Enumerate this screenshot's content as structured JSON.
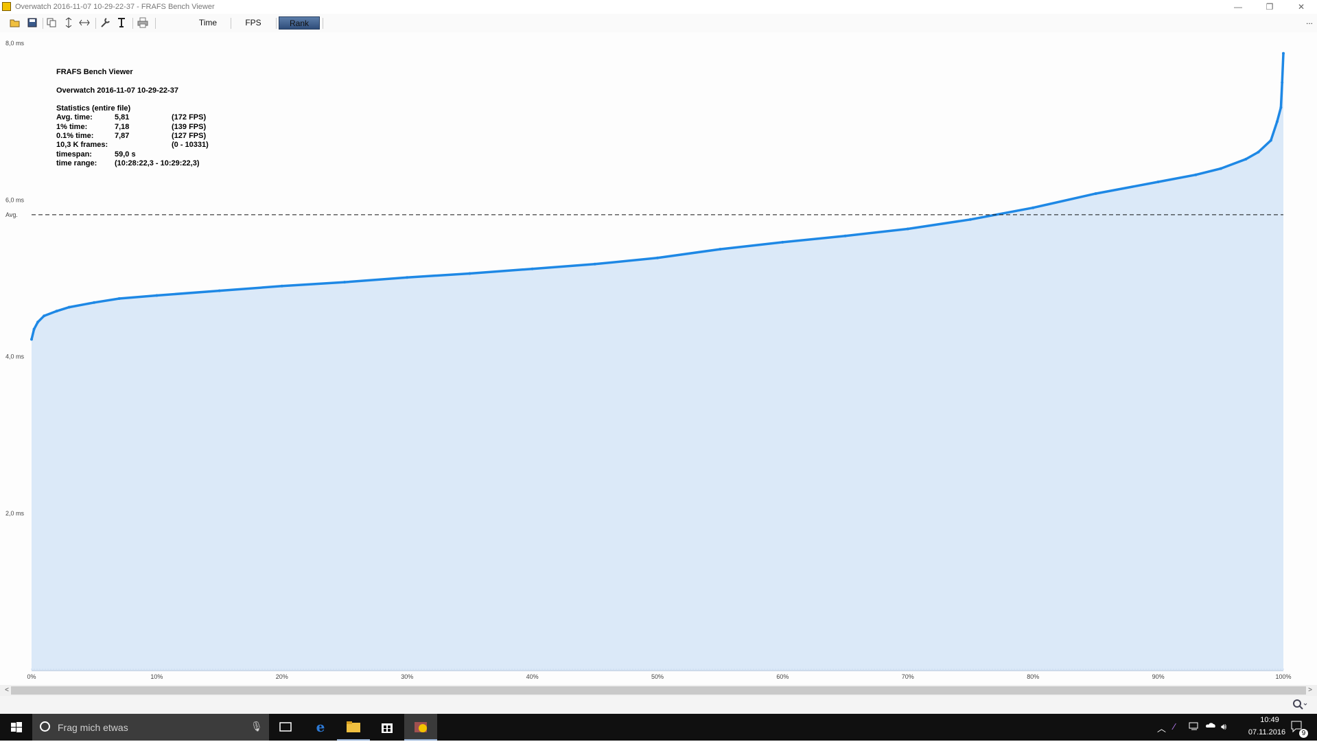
{
  "window": {
    "title": "Overwatch 2016-11-07 10-29-22-37 - FRAFS Bench Viewer",
    "minimize_glyph": "—",
    "restore_glyph": "❐",
    "close_glyph": "✕"
  },
  "toolbar": {
    "icons": [
      "open-folder-icon",
      "save-icon",
      "copy-icon",
      "fit-vertical-icon",
      "fit-horizontal-icon",
      "wrench-icon",
      "text-icon",
      "print-icon"
    ],
    "tabs": [
      {
        "label": "Time",
        "active": false
      },
      {
        "label": "FPS",
        "active": false
      },
      {
        "label": "Rank",
        "active": true
      }
    ],
    "overflow": "..."
  },
  "stats": {
    "app_name": "FRAFS Bench Viewer",
    "file_name": "Overwatch 2016-11-07 10-29-22-37",
    "heading": "Statistics (entire file)",
    "rows": [
      {
        "label": "Avg. time:",
        "value": "5,81",
        "extra": "(172 FPS)"
      },
      {
        "label": "1% time:",
        "value": "7,18",
        "extra": "(139 FPS)"
      },
      {
        "label": "0.1% time:",
        "value": "7,87",
        "extra": "(127 FPS)"
      },
      {
        "label": "10,3 K frames:",
        "value": "",
        "extra": "(0 - 10331)"
      },
      {
        "label": "timespan:",
        "value": "59,0 s",
        "extra": ""
      },
      {
        "label": "time range:",
        "value": "(10:28:22,3 - 10:29:22,3)",
        "extra": ""
      }
    ]
  },
  "chart_data": {
    "type": "area",
    "title": "",
    "xlabel": "",
    "ylabel": "",
    "x_ticks": [
      "0%",
      "10%",
      "20%",
      "30%",
      "40%",
      "50%",
      "60%",
      "70%",
      "80%",
      "90%",
      "100%"
    ],
    "y_ticks": [
      {
        "value": 2.0,
        "label": "2,0 ms"
      },
      {
        "value": 4.0,
        "label": "4,0 ms"
      },
      {
        "value": 6.0,
        "label": "6,0 ms"
      },
      {
        "value": 8.0,
        "label": "8,0 ms"
      }
    ],
    "xlim": [
      0,
      100
    ],
    "ylim": [
      0,
      8.0
    ],
    "average": {
      "value": 5.81,
      "label": "Avg."
    },
    "series": [
      {
        "x": [
          0,
          0.2,
          0.5,
          1,
          2,
          3,
          5,
          7,
          10,
          15,
          20,
          25,
          30,
          35,
          40,
          45,
          50,
          55,
          60,
          65,
          70,
          75,
          80,
          85,
          90,
          93,
          95,
          97,
          98,
          99,
          99.5,
          99.8,
          99.9,
          100
        ],
        "y": [
          4.22,
          4.35,
          4.44,
          4.52,
          4.58,
          4.63,
          4.69,
          4.74,
          4.78,
          4.84,
          4.9,
          4.95,
          5.01,
          5.06,
          5.12,
          5.18,
          5.26,
          5.37,
          5.46,
          5.54,
          5.63,
          5.75,
          5.9,
          6.08,
          6.23,
          6.32,
          6.4,
          6.52,
          6.61,
          6.76,
          7.0,
          7.18,
          7.5,
          7.87
        ],
        "color": "#1e88e5"
      }
    ],
    "fill_color": "#dbe9f8"
  },
  "scrollbar": {
    "left_arrow": "<",
    "right_arrow": ">"
  },
  "statusbar": {
    "zoom_icon": "zoom-icon"
  },
  "taskbar": {
    "search_placeholder": "Frag mich etwas",
    "clock_time": "10:49",
    "clock_date": "07.11.2016",
    "notification_count": "9"
  }
}
